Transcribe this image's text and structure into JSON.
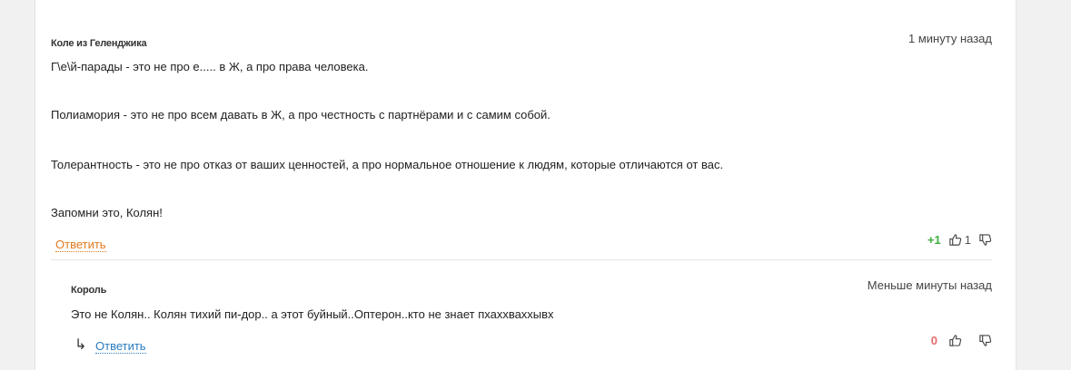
{
  "comments": [
    {
      "author": "Коле из Геленджика",
      "time": "1 минуту назад",
      "paragraphs": [
        "Г\\е\\й-парады - это не про е..... в Ж, а про права человека.",
        "Полиамория - это не про всем давать в Ж, а про честность с партнёрами и с самим собой.",
        "Толерантность - это не про отказ от ваших ценностей, а про нормальное отношение к людям, которые отличаются от вас.",
        "Запомни это, Колян!"
      ],
      "reply_label": "Ответить",
      "score": "+1",
      "likes": "1",
      "score_color": "#3fae3f",
      "reply_color": "#e07b1e"
    },
    {
      "author": "Король",
      "time": "Меньше минуты назад",
      "text": "Это не Колян.. Колян тихий пи-дор.. а этот буйный..Оптерон..кто не знает пхаххваххывх",
      "reply_arrow": "↳",
      "reply_label": "Ответить",
      "score": "0",
      "score_color": "#e46b6b",
      "reply_color": "#2a7bbf"
    }
  ],
  "icons": {
    "like": "thumbs-up-icon",
    "dislike": "thumbs-down-icon",
    "reply_arrow": "reply-arrow-icon"
  }
}
